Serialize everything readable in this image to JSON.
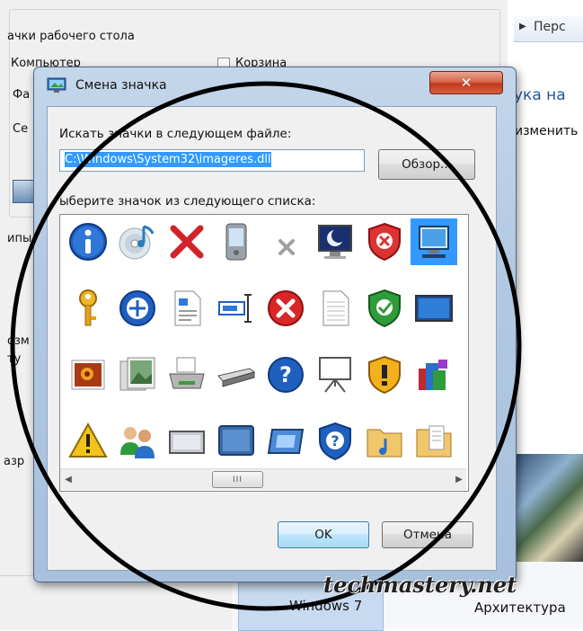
{
  "background_window": {
    "group_title": "ачки рабочего стола",
    "items": [
      "Компьютер",
      "Корзина",
      "Фа",
      "Се"
    ],
    "left_fragments": [
      "ипы",
      "озм",
      "ту",
      "азр"
    ]
  },
  "personalization": {
    "nav_item": "Перс",
    "heading": "ука на",
    "link": "изменить",
    "themes": [
      "Windows 7",
      "Архитектура"
    ]
  },
  "dialog": {
    "title": "Смена значка",
    "close_label": "✕",
    "search_label": "Искать значки в следующем файле:",
    "path_value": "C:\\Windows\\System32\\imageres.dll",
    "browse_label": "Обзор...",
    "list_label": "ыберите значок из следующего списка:",
    "ok_label": "OK",
    "cancel_label": "Отмена",
    "scroll_thumb": "III",
    "icons": [
      [
        "info-icon",
        "cd-music-icon",
        "delete-x-icon",
        "pda-device-icon",
        "small-x-icon",
        "monitor-moon-icon",
        "shield-error-icon",
        "monitor-network-icon"
      ],
      [
        "key-icon",
        "network-globe-icon",
        "document-chart-icon",
        "rename-cursor-icon",
        "error-circle-icon",
        "blank-document-icon",
        "shield-check-icon",
        "monitor-wide-icon"
      ],
      [
        "photo-icon",
        "photo-gallery-icon",
        "printer-icon",
        "scanner-icon",
        "help-icon",
        "presentation-icon",
        "shield-warning-icon",
        "programs-icon"
      ],
      [
        "warning-icon",
        "users-icon",
        "display-panel-icon",
        "display-blue-icon",
        "display-frame-icon",
        "shield-help-icon",
        "music-folder-icon",
        "documents-folder-icon"
      ]
    ],
    "selected_icon": "monitor-network-icon"
  },
  "watermark": "techmastery.net"
}
